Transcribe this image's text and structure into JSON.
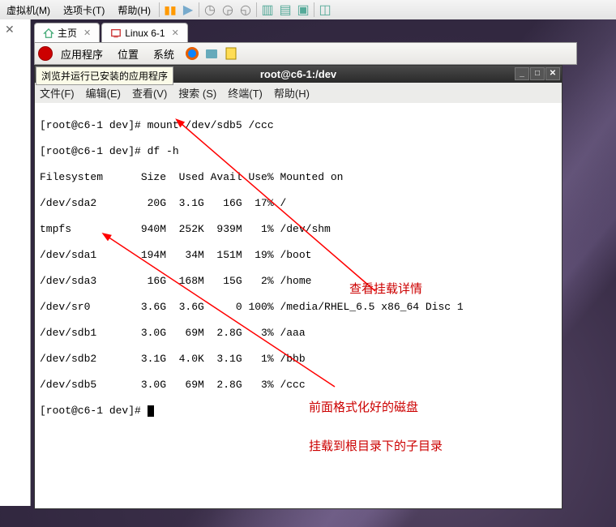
{
  "top_menu": {
    "vm": "虚拟机(M)",
    "tabs": "选项卡(T)",
    "help": "帮助(H)"
  },
  "page_tabs": {
    "home": "主页",
    "linux": "Linux 6-1"
  },
  "gnome": {
    "apps": "应用程序",
    "places": "位置",
    "system": "系统"
  },
  "tooltip": "浏览并运行已安装的应用程序",
  "terminal": {
    "title": "root@c6-1:/dev",
    "menu": {
      "file": "文件(F)",
      "edit": "编辑(E)",
      "view": "查看(V)",
      "search": "搜索 (S)",
      "terminal": "终端(T)",
      "help": "帮助(H)"
    },
    "lines": [
      "[root@c6-1 dev]# mount /dev/sdb5 /ccc",
      "[root@c6-1 dev]# df -h",
      "Filesystem      Size  Used Avail Use% Mounted on",
      "/dev/sda2        20G  3.1G   16G  17% /",
      "tmpfs           940M  252K  939M   1% /dev/shm",
      "/dev/sda1       194M   34M  151M  19% /boot",
      "/dev/sda3        16G  168M   15G   2% /home",
      "/dev/sr0        3.6G  3.6G     0 100% /media/RHEL_6.5 x86_64 Disc 1",
      "/dev/sdb1       3.0G   69M  2.8G   3% /aaa",
      "/dev/sdb2       3.1G  4.0K  3.1G   1% /bbb",
      "/dev/sdb5       3.0G   69M  2.8G   3% /ccc",
      "[root@c6-1 dev]# "
    ]
  },
  "annotations": {
    "a1": "查看挂载详情",
    "a2_line1": "前面格式化好的磁盘",
    "a2_line2": "挂载到根目录下的子目录"
  }
}
